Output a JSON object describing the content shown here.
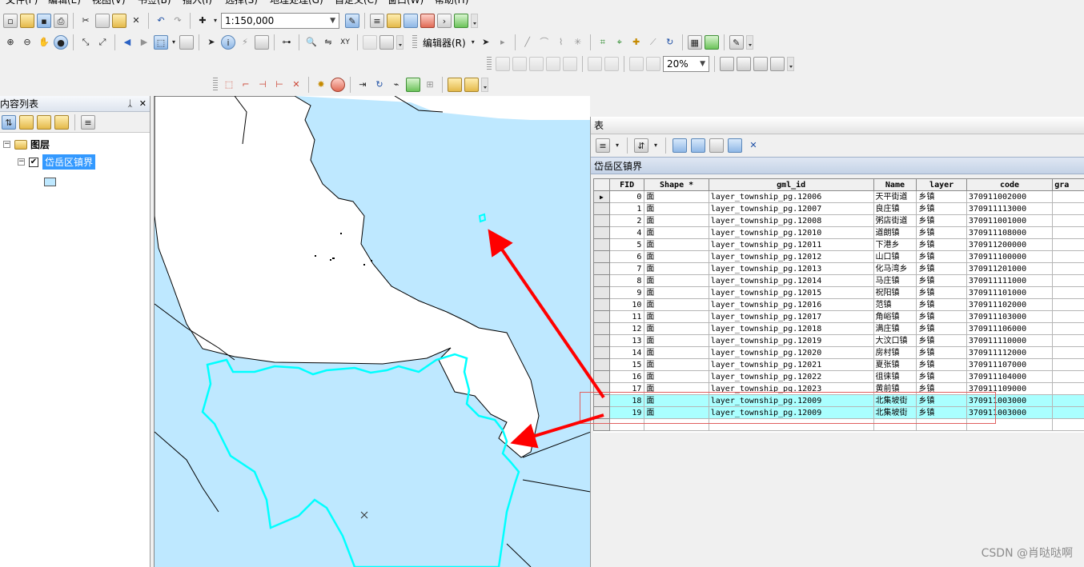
{
  "menu": [
    "文件(F)",
    "编辑(E)",
    "视图(V)",
    "书签(B)",
    "插入(I)",
    "选择(S)",
    "地理处理(G)",
    "自定义(C)",
    "窗口(W)",
    "帮助(H)"
  ],
  "toolbar": {
    "scale_value": "1:150,000",
    "editor_label": "编辑器(R)",
    "zoom_value": "20%"
  },
  "toc": {
    "title": "内容列表",
    "pin_glyph": "ᛣ",
    "close_glyph": "✕",
    "root_label": "图层",
    "layer_label": "岱岳区镇界"
  },
  "table_window": {
    "title": "表",
    "tab_label": "岱岳区镇界",
    "columns": [
      "FID",
      "Shape *",
      "gml_id",
      "Name",
      "layer",
      "code",
      "gra"
    ],
    "rows": [
      {
        "fid": "0",
        "shape": "面",
        "gml_id": "layer_township_pg.12006",
        "name": "天平街道",
        "layer": "乡镇",
        "code": "370911002000",
        "highlighted": false
      },
      {
        "fid": "1",
        "shape": "面",
        "gml_id": "layer_township_pg.12007",
        "name": "良庄镇",
        "layer": "乡镇",
        "code": "370911113000",
        "highlighted": false
      },
      {
        "fid": "2",
        "shape": "面",
        "gml_id": "layer_township_pg.12008",
        "name": "粥店街道",
        "layer": "乡镇",
        "code": "370911001000",
        "highlighted": false
      },
      {
        "fid": "4",
        "shape": "面",
        "gml_id": "layer_township_pg.12010",
        "name": "道朗镇",
        "layer": "乡镇",
        "code": "370911108000",
        "highlighted": false
      },
      {
        "fid": "5",
        "shape": "面",
        "gml_id": "layer_township_pg.12011",
        "name": "下港乡",
        "layer": "乡镇",
        "code": "370911200000",
        "highlighted": false
      },
      {
        "fid": "6",
        "shape": "面",
        "gml_id": "layer_township_pg.12012",
        "name": "山口镇",
        "layer": "乡镇",
        "code": "370911100000",
        "highlighted": false
      },
      {
        "fid": "7",
        "shape": "面",
        "gml_id": "layer_township_pg.12013",
        "name": "化马湾乡",
        "layer": "乡镇",
        "code": "370911201000",
        "highlighted": false
      },
      {
        "fid": "8",
        "shape": "面",
        "gml_id": "layer_township_pg.12014",
        "name": "马庄镇",
        "layer": "乡镇",
        "code": "370911111000",
        "highlighted": false
      },
      {
        "fid": "9",
        "shape": "面",
        "gml_id": "layer_township_pg.12015",
        "name": "祝阳镇",
        "layer": "乡镇",
        "code": "370911101000",
        "highlighted": false
      },
      {
        "fid": "10",
        "shape": "面",
        "gml_id": "layer_township_pg.12016",
        "name": "范镇",
        "layer": "乡镇",
        "code": "370911102000",
        "highlighted": false
      },
      {
        "fid": "11",
        "shape": "面",
        "gml_id": "layer_township_pg.12017",
        "name": "角峪镇",
        "layer": "乡镇",
        "code": "370911103000",
        "highlighted": false
      },
      {
        "fid": "12",
        "shape": "面",
        "gml_id": "layer_township_pg.12018",
        "name": "满庄镇",
        "layer": "乡镇",
        "code": "370911106000",
        "highlighted": false
      },
      {
        "fid": "13",
        "shape": "面",
        "gml_id": "layer_township_pg.12019",
        "name": "大汶口镇",
        "layer": "乡镇",
        "code": "370911110000",
        "highlighted": false
      },
      {
        "fid": "14",
        "shape": "面",
        "gml_id": "layer_township_pg.12020",
        "name": "房村镇",
        "layer": "乡镇",
        "code": "370911112000",
        "highlighted": false
      },
      {
        "fid": "15",
        "shape": "面",
        "gml_id": "layer_township_pg.12021",
        "name": "夏张镇",
        "layer": "乡镇",
        "code": "370911107000",
        "highlighted": false
      },
      {
        "fid": "16",
        "shape": "面",
        "gml_id": "layer_township_pg.12022",
        "name": "徂徕镇",
        "layer": "乡镇",
        "code": "370911104000",
        "highlighted": false
      },
      {
        "fid": "17",
        "shape": "面",
        "gml_id": "layer_township_pg.12023",
        "name": "黄前镇",
        "layer": "乡镇",
        "code": "370911109000",
        "highlighted": false
      },
      {
        "fid": "18",
        "shape": "面",
        "gml_id": "layer_township_pg.12009",
        "name": "北集坡街",
        "layer": "乡镇",
        "code": "370911003000",
        "highlighted": true
      },
      {
        "fid": "19",
        "shape": "面",
        "gml_id": "layer_township_pg.12009",
        "name": "北集坡街",
        "layer": "乡镇",
        "code": "370911003000",
        "highlighted": true
      }
    ]
  },
  "colors": {
    "map_fill": "#bee8ff",
    "selection_outline": "#00ffff",
    "row_highlight": "#aaffff",
    "annotation_arrow": "#ff0000"
  },
  "watermark": "CSDN @肖哒哒啊"
}
